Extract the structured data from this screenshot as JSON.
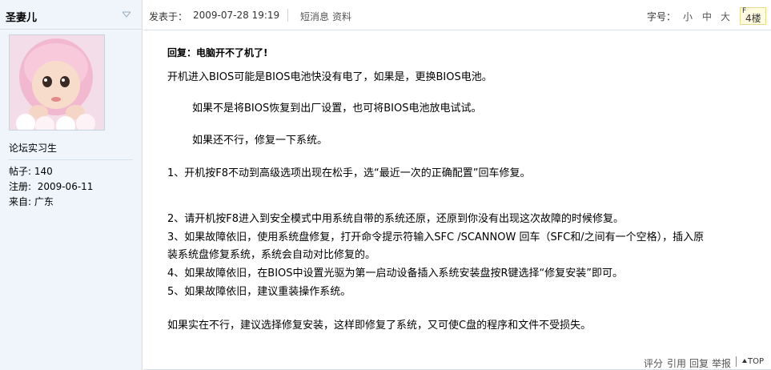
{
  "user": {
    "name": "圣妻儿",
    "title": "论坛实习生",
    "stats": [
      {
        "label": "帖子:",
        "value": "140"
      },
      {
        "label": "注册:",
        "value": "2009-06-11"
      },
      {
        "label": "来自:",
        "value": "广东"
      }
    ]
  },
  "post_header": {
    "posted_label": "发表于：",
    "posted_at": "2009-07-28 19:19",
    "links": [
      "短消息",
      "资料"
    ],
    "font_label": "字号：",
    "font_sizes": [
      "小",
      "中",
      "大"
    ],
    "floor": "4楼",
    "floor_marker": "F"
  },
  "post": {
    "title": "回复：电脑开不了机了!",
    "lines": [
      "开机进入BIOS可能是BIOS电池快没有电了，如果是，更换BIOS电池。",
      "如果不是将BIOS恢复到出厂设置，也可将BIOS电池放电试试。",
      "如果还不行，修复一下系统。",
      "1、开机按F8不动到高级选项出现在松手，选“最近一次的正确配置”回车修复。",
      "2、请开机按F8进入到安全模式中用系统自带的系统还原，还原到你没有出现这次故障的时候修复。",
      "3、如果故障依旧，使用系统盘修复，打开命令提示符输入SFC /SCANNOW 回车（SFC和/之间有一个空格），插入原",
      "装系统盘修复系统，系统会自动对比修复的。",
      "4、如果故障依旧，在BIOS中设置光驱为第一启动设备插入系统安装盘按R键选择“修复安装”即可。",
      "5、如果故障依旧，建议重装操作系统。",
      "如果实在不行，建议选择修复安装，这样即修复了系统，又可使C盘的程序和文件不受损失。"
    ]
  },
  "actions": {
    "rate": "评分",
    "quote": "引用",
    "reply": "回复",
    "report": "举报",
    "top": "TOP"
  },
  "colors": {
    "sidebar_bg": "#eff5fb",
    "border": "#cfdbe8",
    "floor_bg": "#fffbe0"
  }
}
